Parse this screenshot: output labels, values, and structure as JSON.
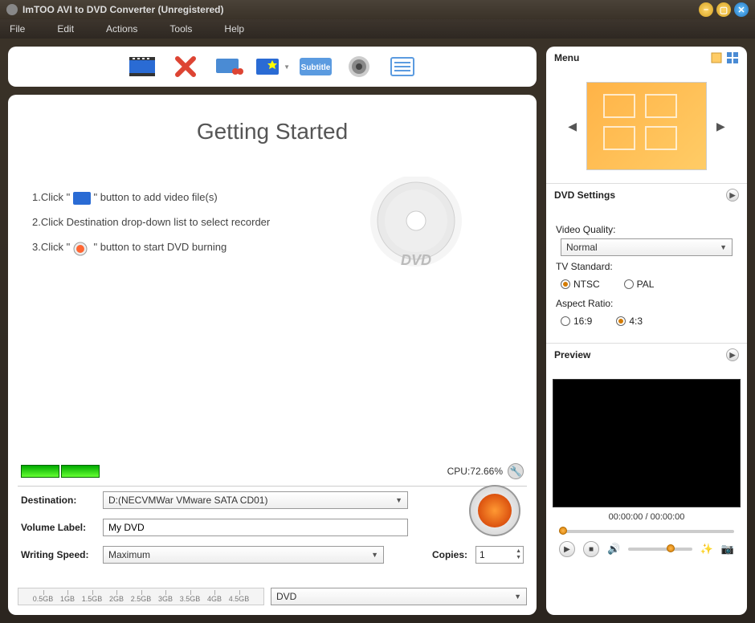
{
  "title": "ImTOO AVI to DVD Converter (Unregistered)",
  "menubar": [
    "File",
    "Edit",
    "Actions",
    "Tools",
    "Help"
  ],
  "toolbar_icons": [
    "add-video-icon",
    "remove-icon",
    "clip-icon",
    "effects-icon",
    "subtitle-icon",
    "audio-icon",
    "list-icon"
  ],
  "getting_started_title": "Getting Started",
  "instructions": {
    "line1_pre": "1.Click \"",
    "line1_post": "\" button to add video file(s)",
    "line2": "2.Click Destination drop-down list to select recorder",
    "line3_pre": "3.Click \"",
    "line3_post": "\" button to start DVD burning"
  },
  "cpu_label": "CPU:72.66%",
  "destination_label": "Destination:",
  "destination_value": "D:(NECVMWar VMware SATA CD01)",
  "volume_label_label": "Volume Label:",
  "volume_label_value": "My DVD",
  "writing_speed_label": "Writing Speed:",
  "writing_speed_value": "Maximum",
  "copies_label": "Copies:",
  "copies_value": "1",
  "ruler_ticks": [
    "0.5GB",
    "1GB",
    "1.5GB",
    "2GB",
    "2.5GB",
    "3GB",
    "3.5GB",
    "4GB",
    "4.5GB"
  ],
  "dvd_type": "DVD",
  "right": {
    "menu_label": "Menu",
    "dvd_settings_label": "DVD Settings",
    "video_quality_label": "Video Quality:",
    "video_quality_value": "Normal",
    "tv_standard_label": "TV Standard:",
    "tv_ntsc": "NTSC",
    "tv_pal": "PAL",
    "aspect_label": "Aspect Ratio:",
    "aspect_169": "16:9",
    "aspect_43": "4:3",
    "preview_label": "Preview",
    "time": "00:00:00 / 00:00:00"
  }
}
